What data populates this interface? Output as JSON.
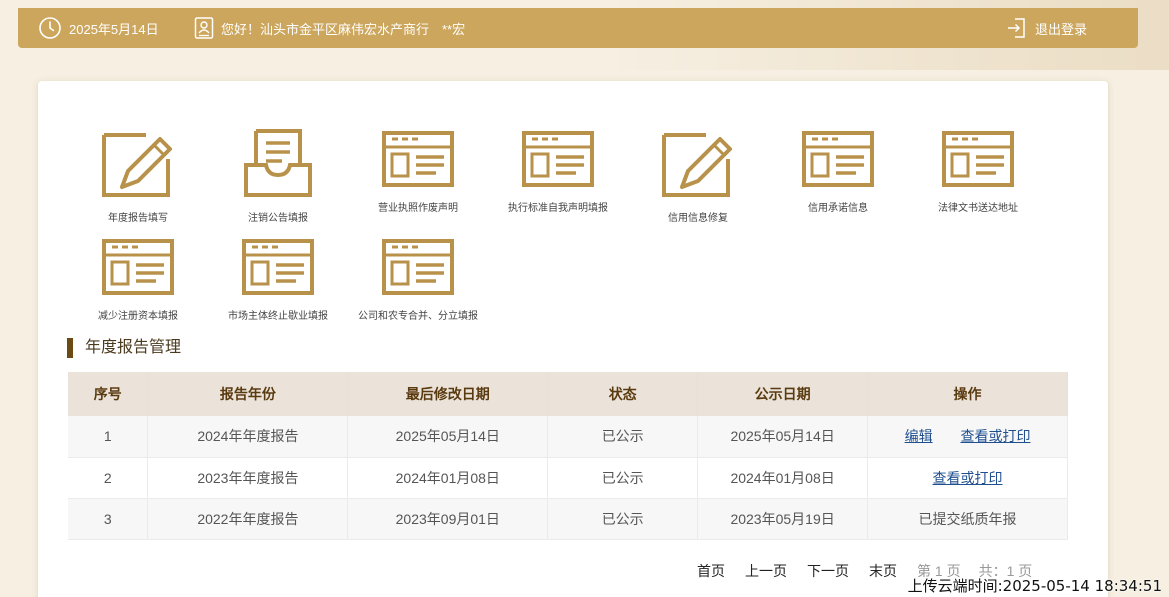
{
  "header": {
    "date": "2025年5月14日",
    "greeting": "您好！汕头市金平区麻伟宏水产商行",
    "user": "**宏",
    "logout": "退出登录"
  },
  "colors": {
    "gold": "#cca65c",
    "icon_gold": "#b8924a",
    "title_bar": "#6b4a14",
    "link": "#1f4f8f"
  },
  "functions": [
    {
      "label": "年度报告填写",
      "icon": "edit-icon"
    },
    {
      "label": "注销公告填报",
      "icon": "inbox-icon"
    },
    {
      "label": "营业执照作废声明",
      "icon": "form-icon"
    },
    {
      "label": "执行标准自我声明填报",
      "icon": "form-icon"
    },
    {
      "label": "信用信息修复",
      "icon": "edit-icon"
    },
    {
      "label": "信用承诺信息",
      "icon": "form-icon"
    },
    {
      "label": "法律文书送达地址",
      "icon": "form-icon"
    },
    {
      "label": "减少注册资本填报",
      "icon": "form-icon"
    },
    {
      "label": "市场主体终止歇业填报",
      "icon": "form-icon"
    },
    {
      "label": "公司和农专合并、分立填报",
      "icon": "form-icon"
    }
  ],
  "section_title": "年度报告管理",
  "table": {
    "headers": [
      "序号",
      "报告年份",
      "最后修改日期",
      "状态",
      "公示日期",
      "操作"
    ],
    "rows": [
      {
        "no": "1",
        "year": "2024年年度报告",
        "modified": "2025年05月14日",
        "status": "已公示",
        "published": "2025年05月14日",
        "ops": [
          "编辑",
          "查看或打印"
        ],
        "note": ""
      },
      {
        "no": "2",
        "year": "2023年年度报告",
        "modified": "2024年01月08日",
        "status": "已公示",
        "published": "2024年01月08日",
        "ops": [
          "查看或打印"
        ],
        "note": ""
      },
      {
        "no": "3",
        "year": "2022年年度报告",
        "modified": "2023年09月01日",
        "status": "已公示",
        "published": "2023年05月19日",
        "ops": [],
        "note": "已提交纸质年报"
      }
    ]
  },
  "pager": {
    "first": "首页",
    "prev": "上一页",
    "next": "下一页",
    "last": "末页",
    "page_info": "第 1 页",
    "total_info": "共：1 页"
  },
  "watermark": "上传云端时间:2025-05-14 18:34:51"
}
